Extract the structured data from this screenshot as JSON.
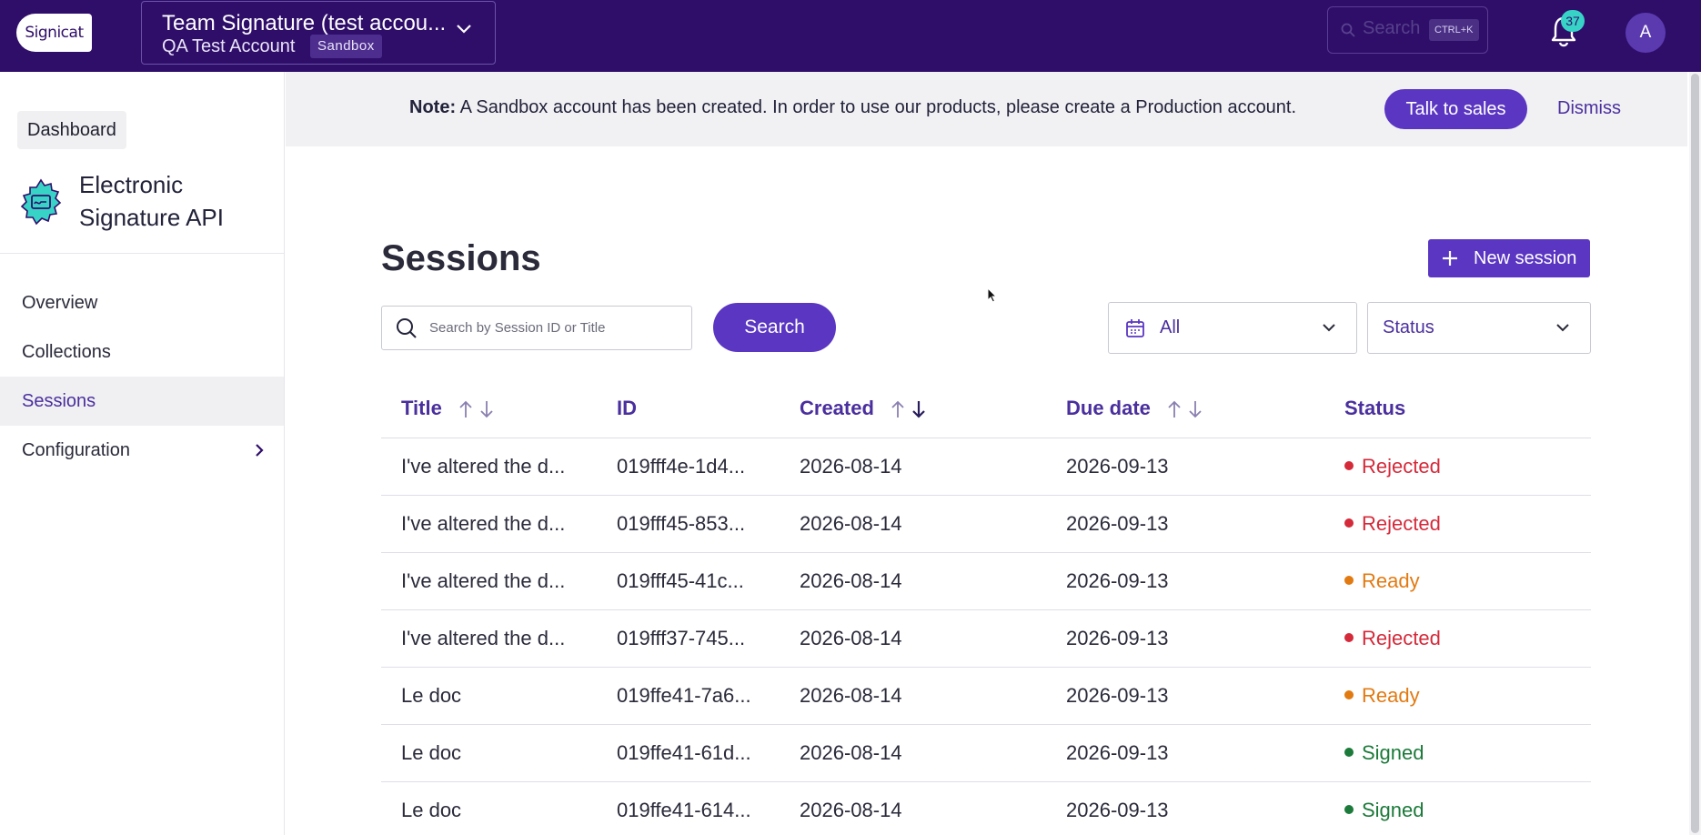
{
  "topbar": {
    "logo_text": "Signicat",
    "account_name": "Team Signature (test accou...",
    "account_sub": "QA Test Account",
    "account_badge": "Sandbox",
    "search_placeholder": "Search",
    "search_shortcut": "CTRL+K",
    "notification_count": "37",
    "avatar_initial": "A"
  },
  "sidebar": {
    "dashboard_label": "Dashboard",
    "product_name": "Electronic Signature API",
    "items": [
      {
        "label": "Overview"
      },
      {
        "label": "Collections"
      },
      {
        "label": "Sessions"
      },
      {
        "label": "Configuration"
      }
    ]
  },
  "notice": {
    "label": "Note:",
    "message": "A Sandbox account has been created. In order to use our products, please create a Production account.",
    "talk_label": "Talk to sales",
    "dismiss_label": "Dismiss"
  },
  "main": {
    "title": "Sessions",
    "new_session_label": "New session",
    "search_placeholder": "Search by Session ID or Title",
    "search_button": "Search",
    "date_filter_value": "All",
    "status_filter_value": "Status"
  },
  "table": {
    "columns": [
      "Title",
      "ID",
      "Created",
      "Due date",
      "Status"
    ],
    "rows": [
      {
        "title": "I've altered the d...",
        "id": "019fff4e-1d4...",
        "created": "2026-08-14",
        "due": "2026-09-13",
        "status": "Rejected"
      },
      {
        "title": "I've altered the d...",
        "id": "019fff45-853...",
        "created": "2026-08-14",
        "due": "2026-09-13",
        "status": "Rejected"
      },
      {
        "title": "I've altered the d...",
        "id": "019fff45-41c...",
        "created": "2026-08-14",
        "due": "2026-09-13",
        "status": "Ready"
      },
      {
        "title": "I've altered the d...",
        "id": "019fff37-745...",
        "created": "2026-08-14",
        "due": "2026-09-13",
        "status": "Rejected"
      },
      {
        "title": "Le doc",
        "id": "019ffe41-7a6...",
        "created": "2026-08-14",
        "due": "2026-09-13",
        "status": "Ready"
      },
      {
        "title": "Le doc",
        "id": "019ffe41-61d...",
        "created": "2026-08-14",
        "due": "2026-09-13",
        "status": "Signed"
      },
      {
        "title": "Le doc",
        "id": "019ffe41-614...",
        "created": "2026-08-14",
        "due": "2026-09-13",
        "status": "Signed"
      }
    ]
  },
  "colors": {
    "topbar": "#2f0e6a",
    "accent": "#5a36c2",
    "rejected": "#d42a3a",
    "ready": "#e27a12",
    "signed": "#1c7a3a"
  }
}
